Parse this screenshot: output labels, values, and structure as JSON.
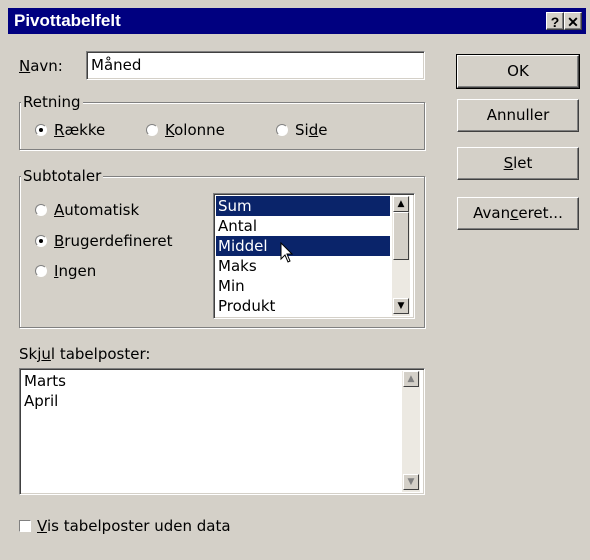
{
  "dialog": {
    "title": "Pivottabelfelt",
    "help_glyph": "?",
    "close_glyph": "✕"
  },
  "name_field": {
    "label_pre": "",
    "label_mnemonic": "N",
    "label_post": "avn:",
    "value": "Måned"
  },
  "buttons": {
    "ok": "OK",
    "cancel": "Annuller",
    "delete_mnemonic": "S",
    "delete_rest": "let",
    "advanced_pre": "Avan",
    "advanced_mnemonic": "c",
    "advanced_post": "eret..."
  },
  "orientation": {
    "label": "Retning",
    "options": [
      {
        "pre": "",
        "mnemonic": "R",
        "post": "ække",
        "selected": true
      },
      {
        "pre": "",
        "mnemonic": "K",
        "post": "olonne",
        "selected": false
      },
      {
        "pre": "Si",
        "mnemonic": "d",
        "post": "e",
        "selected": false
      }
    ]
  },
  "subtotals": {
    "label": "Subtotaler",
    "options": [
      {
        "pre": "",
        "mnemonic": "A",
        "post": "utomatisk",
        "selected": false
      },
      {
        "pre": "",
        "mnemonic": "B",
        "post": "rugerdefineret",
        "selected": true
      },
      {
        "pre": "",
        "mnemonic": "I",
        "post": "ngen",
        "selected": false
      }
    ],
    "functions": [
      "Sum",
      "Antal",
      "Middel",
      "Maks",
      "Min",
      "Produkt"
    ],
    "selected_functions": [
      "Sum",
      "Middel"
    ]
  },
  "hide_items": {
    "label_pre": "Skj",
    "label_mnemonic": "u",
    "label_post": "l tabelposter:",
    "items": [
      "Marts",
      "April"
    ]
  },
  "show_empty": {
    "pre": "",
    "mnemonic": "V",
    "post": "is tabelposter uden data",
    "checked": false
  },
  "colors": {
    "titlebar": "#000080",
    "selection": "#0a246a",
    "face": "#d4d0c8"
  }
}
